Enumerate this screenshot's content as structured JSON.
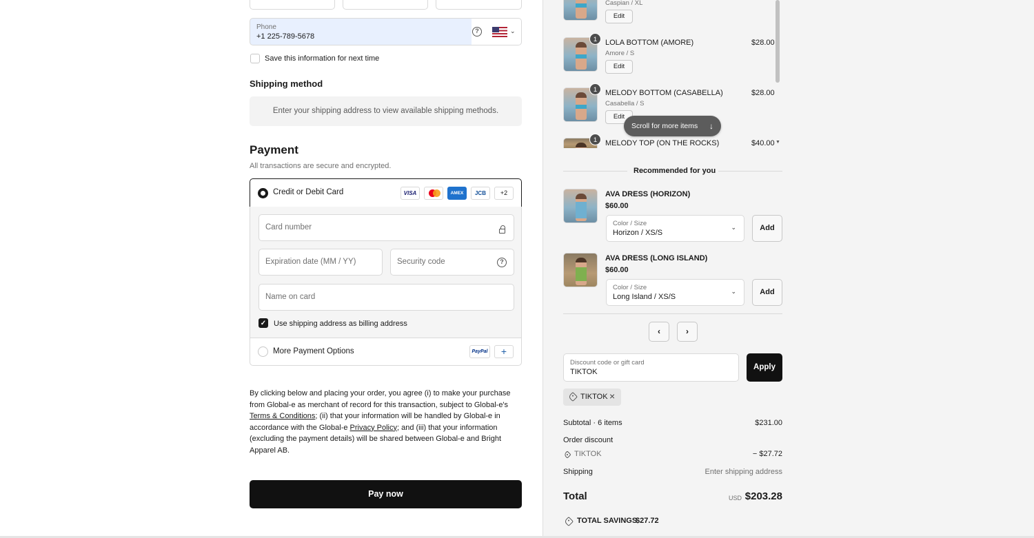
{
  "contact": {
    "phone_label": "Phone",
    "phone_value": "+1 225-789-5678",
    "save_info_label": "Save this information for next time"
  },
  "shipping": {
    "heading": "Shipping method",
    "placeholder": "Enter your shipping address to view available shipping methods."
  },
  "payment": {
    "heading": "Payment",
    "subheading": "All transactions are secure and encrypted.",
    "card_option_label": "Credit or Debit Card",
    "brands": [
      "VISA",
      "",
      "AMEX",
      "JCB",
      "+2"
    ],
    "card_number_placeholder": "Card number",
    "expiry_placeholder": "Expiration date (MM / YY)",
    "security_placeholder": "Security code",
    "name_placeholder": "Name on card",
    "billing_same_label": "Use shipping address as billing address",
    "more_options_label": "More Payment Options",
    "paypal_label": "PayPal"
  },
  "legal": {
    "part1": "By clicking below and placing your order, you agree (i) to make your purchase from Global-e as merchant of record for this transaction, subject to Global-e's ",
    "terms_link": "Terms & Conditions",
    "part2": "; (ii) that your information will be handled by Global-e in accordance with the Global-e ",
    "privacy_link": "Privacy Policy",
    "part3": "; and (iii) that your information (excluding the payment details) will be shared between Global-e and Bright Apparel AB."
  },
  "pay_now_label": "Pay now",
  "cart": {
    "items": [
      {
        "name": "",
        "variant": "Caspian / XL",
        "price": "",
        "qty": "",
        "edit": "Edit"
      },
      {
        "name": "LOLA BOTTOM (AMORE)",
        "variant": "Amore / S",
        "price": "$28.00",
        "qty": "1",
        "edit": "Edit"
      },
      {
        "name": "MELODY BOTTOM (CASABELLA)",
        "variant": "Casabella / S",
        "price": "$28.00",
        "qty": "1",
        "edit": "Edit"
      },
      {
        "name": "MELODY TOP (ON THE ROCKS)",
        "variant": "",
        "price": "$40.00",
        "qty": "1",
        "edit": ""
      }
    ],
    "scroll_hint": "Scroll for more items"
  },
  "recommended": {
    "heading": "Recommended for you",
    "items": [
      {
        "name": "AVA DRESS (HORIZON)",
        "price": "$60.00",
        "select_label": "Color / Size",
        "select_value": "Horizon / XS/S",
        "add": "Add"
      },
      {
        "name": "AVA DRESS (LONG ISLAND)",
        "price": "$60.00",
        "select_label": "Color / Size",
        "select_value": "Long Island / XS/S",
        "add": "Add"
      }
    ]
  },
  "discount": {
    "label": "Discount code or gift card",
    "value": "TIKTOK",
    "apply": "Apply",
    "applied_code": "TIKTOK"
  },
  "summary": {
    "subtotal_label": "Subtotal · 6 items",
    "subtotal_value": "$231.00",
    "order_discount_label": "Order discount",
    "discount_code": "TIKTOK",
    "discount_value": "− $27.72",
    "shipping_label": "Shipping",
    "shipping_value": "Enter shipping address",
    "total_label": "Total",
    "currency": "USD",
    "total_value": "$203.28",
    "savings_label": "TOTAL SAVINGS",
    "savings_value": "$27.72"
  }
}
